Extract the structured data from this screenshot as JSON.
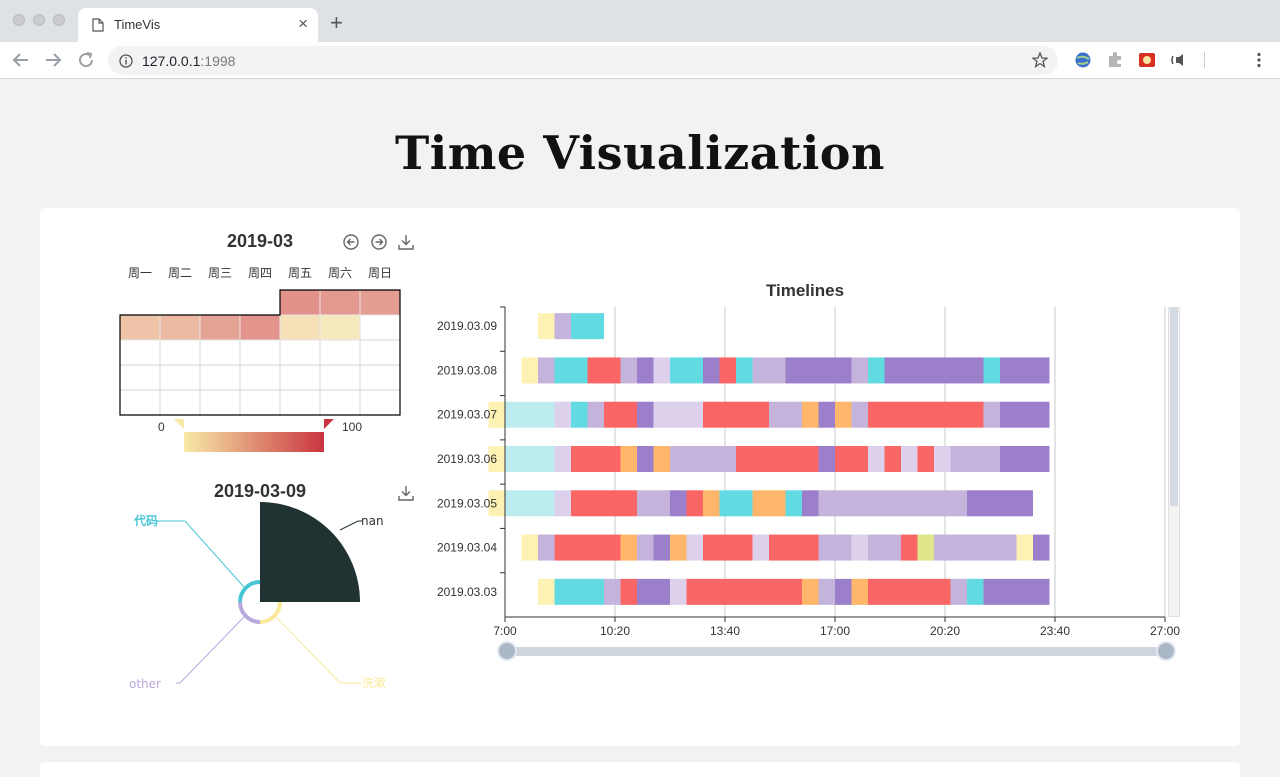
{
  "browser": {
    "tab_title": "TimeVis",
    "url_host": "127.0.0.1",
    "url_port": ":1998"
  },
  "page": {
    "title": "Time Visualization"
  },
  "calendar": {
    "title": "2019-03",
    "weekdays": [
      "周一",
      "周二",
      "周三",
      "周四",
      "周五",
      "周六",
      "周日"
    ],
    "scale_min": "0",
    "scale_max": "100",
    "colors": {
      "low": "#f7eaa8",
      "high": "#c9353f"
    },
    "cells": [
      {
        "row": 0,
        "col": 4,
        "value": 75
      },
      {
        "row": 0,
        "col": 5,
        "value": 68
      },
      {
        "row": 0,
        "col": 6,
        "value": 65
      },
      {
        "row": 1,
        "col": 0,
        "value": 35
      },
      {
        "row": 1,
        "col": 1,
        "value": 42
      },
      {
        "row": 1,
        "col": 2,
        "value": 60
      },
      {
        "row": 1,
        "col": 3,
        "value": 72
      },
      {
        "row": 1,
        "col": 4,
        "value": 12
      },
      {
        "row": 1,
        "col": 5,
        "value": 5
      }
    ],
    "icons": [
      "prev-icon",
      "next-icon",
      "download-icon"
    ]
  },
  "daily": {
    "title": "2019-03-09",
    "labels": {
      "code": "代码",
      "nan": "nan",
      "other": "other",
      "wash": "洗漱"
    },
    "colors": {
      "code": "#49c6d6",
      "nan": "#213232",
      "other": "#b8a8dc",
      "wash": "#fbe99a"
    }
  },
  "timeline": {
    "title": "Timelines",
    "x_ticks": [
      "7:00",
      "10:20",
      "13:40",
      "17:00",
      "20:20",
      "23:40",
      "27:00"
    ],
    "colors": {
      "Y": "#fdf2b3",
      "C": "#bdecf0",
      "L": "#dcd0ec",
      "P": "#c4b4dc",
      "T": "#62dae2",
      "R": "#fa6666",
      "O": "#fdb66a",
      "V": "#9b7fcb",
      "G": "#dfe589"
    },
    "rows": [
      {
        "label": "2019.03.09",
        "segs": [
          [
            8.0,
            8.5,
            "Y"
          ],
          [
            8.5,
            9.0,
            "P"
          ],
          [
            9.0,
            10.0,
            "T"
          ]
        ]
      },
      {
        "label": "2019.03.08",
        "segs": [
          [
            7.5,
            8.0,
            "Y"
          ],
          [
            8.0,
            8.5,
            "P"
          ],
          [
            8.5,
            9.5,
            "T"
          ],
          [
            9.5,
            10.5,
            "R"
          ],
          [
            10.5,
            11.0,
            "P"
          ],
          [
            11.0,
            11.5,
            "V"
          ],
          [
            11.5,
            12.0,
            "L"
          ],
          [
            12.0,
            13.0,
            "T"
          ],
          [
            13.0,
            13.5,
            "V"
          ],
          [
            13.5,
            14.0,
            "R"
          ],
          [
            14.0,
            14.5,
            "T"
          ],
          [
            14.5,
            15.5,
            "P"
          ],
          [
            15.5,
            17.5,
            "V"
          ],
          [
            17.5,
            18.0,
            "P"
          ],
          [
            18.0,
            18.5,
            "T"
          ],
          [
            18.5,
            21.5,
            "V"
          ],
          [
            21.5,
            22.0,
            "T"
          ],
          [
            22.0,
            23.5,
            "V"
          ]
        ]
      },
      {
        "label": "2019.03.07",
        "segs": [
          [
            6.5,
            7.0,
            "Y"
          ],
          [
            7.0,
            8.5,
            "C"
          ],
          [
            8.5,
            9.0,
            "L"
          ],
          [
            9.0,
            9.5,
            "T"
          ],
          [
            9.5,
            10.0,
            "P"
          ],
          [
            10.0,
            11.0,
            "R"
          ],
          [
            11.0,
            11.5,
            "V"
          ],
          [
            11.5,
            13.0,
            "L"
          ],
          [
            13.0,
            15.0,
            "R"
          ],
          [
            15.0,
            16.0,
            "P"
          ],
          [
            16.0,
            16.5,
            "O"
          ],
          [
            16.5,
            17.0,
            "V"
          ],
          [
            17.0,
            17.5,
            "O"
          ],
          [
            17.5,
            18.0,
            "P"
          ],
          [
            18.0,
            21.5,
            "R"
          ],
          [
            21.5,
            22.0,
            "P"
          ],
          [
            22.0,
            23.5,
            "V"
          ]
        ]
      },
      {
        "label": "2019.03.06",
        "segs": [
          [
            6.5,
            7.0,
            "Y"
          ],
          [
            7.0,
            8.5,
            "C"
          ],
          [
            8.5,
            9.0,
            "L"
          ],
          [
            9.0,
            10.5,
            "R"
          ],
          [
            10.5,
            11.0,
            "O"
          ],
          [
            11.0,
            11.5,
            "V"
          ],
          [
            11.5,
            12.0,
            "O"
          ],
          [
            12.0,
            14.0,
            "P"
          ],
          [
            14.0,
            16.5,
            "R"
          ],
          [
            16.5,
            17.0,
            "V"
          ],
          [
            17.0,
            18.0,
            "R"
          ],
          [
            18.0,
            18.5,
            "L"
          ],
          [
            18.5,
            19.0,
            "R"
          ],
          [
            19.0,
            19.5,
            "L"
          ],
          [
            19.5,
            20.0,
            "R"
          ],
          [
            20.0,
            20.5,
            "L"
          ],
          [
            20.5,
            22.0,
            "P"
          ],
          [
            22.0,
            23.5,
            "V"
          ]
        ]
      },
      {
        "label": "2019.03.05",
        "segs": [
          [
            6.5,
            7.0,
            "Y"
          ],
          [
            7.0,
            8.5,
            "C"
          ],
          [
            8.5,
            9.0,
            "L"
          ],
          [
            9.0,
            11.0,
            "R"
          ],
          [
            11.0,
            12.0,
            "P"
          ],
          [
            12.0,
            12.5,
            "V"
          ],
          [
            12.5,
            13.0,
            "R"
          ],
          [
            13.0,
            13.5,
            "O"
          ],
          [
            13.5,
            14.5,
            "T"
          ],
          [
            14.5,
            15.5,
            "O"
          ],
          [
            15.5,
            16.0,
            "T"
          ],
          [
            16.0,
            16.5,
            "V"
          ],
          [
            16.5,
            21.0,
            "P"
          ],
          [
            21.0,
            23.0,
            "V"
          ]
        ]
      },
      {
        "label": "2019.03.04",
        "segs": [
          [
            7.5,
            8.0,
            "Y"
          ],
          [
            8.0,
            8.5,
            "P"
          ],
          [
            8.5,
            10.5,
            "R"
          ],
          [
            10.5,
            11.0,
            "O"
          ],
          [
            11.0,
            11.5,
            "P"
          ],
          [
            11.5,
            12.0,
            "V"
          ],
          [
            12.0,
            12.5,
            "O"
          ],
          [
            12.5,
            13.0,
            "L"
          ],
          [
            13.0,
            14.5,
            "R"
          ],
          [
            14.5,
            15.0,
            "L"
          ],
          [
            15.0,
            16.5,
            "R"
          ],
          [
            16.5,
            17.5,
            "P"
          ],
          [
            17.5,
            18.0,
            "L"
          ],
          [
            18.0,
            19.0,
            "P"
          ],
          [
            19.0,
            19.5,
            "R"
          ],
          [
            19.5,
            20.0,
            "G"
          ],
          [
            20.0,
            22.5,
            "P"
          ],
          [
            22.5,
            23.0,
            "Y"
          ],
          [
            23.0,
            23.5,
            "V"
          ]
        ]
      },
      {
        "label": "2019.03.03",
        "segs": [
          [
            8.0,
            8.5,
            "Y"
          ],
          [
            8.5,
            10.0,
            "T"
          ],
          [
            10.0,
            10.5,
            "P"
          ],
          [
            10.5,
            11.0,
            "R"
          ],
          [
            11.0,
            12.0,
            "V"
          ],
          [
            12.0,
            12.5,
            "L"
          ],
          [
            12.5,
            16.0,
            "R"
          ],
          [
            16.0,
            16.5,
            "O"
          ],
          [
            16.5,
            17.0,
            "P"
          ],
          [
            17.0,
            17.5,
            "V"
          ],
          [
            17.5,
            18.0,
            "O"
          ],
          [
            18.0,
            20.5,
            "R"
          ],
          [
            20.5,
            21.0,
            "P"
          ],
          [
            21.0,
            21.5,
            "T"
          ],
          [
            21.5,
            23.5,
            "V"
          ]
        ]
      }
    ]
  }
}
